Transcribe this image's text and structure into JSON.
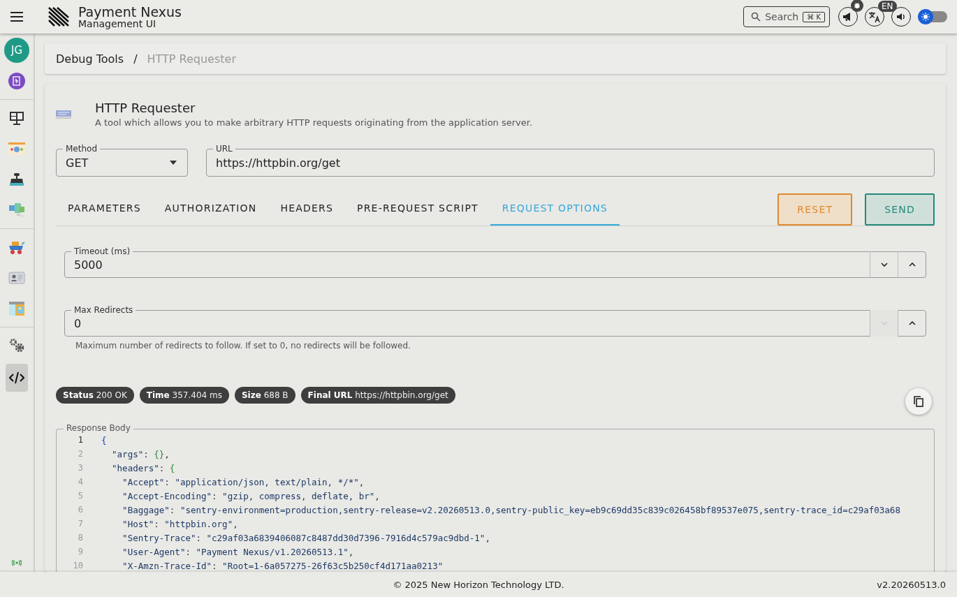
{
  "app": {
    "title": "Payment Nexus",
    "subtitle": "Management UI"
  },
  "toolbar": {
    "search_placeholder": "Search",
    "shortcut": "⌘ K",
    "language": "EN",
    "theme_toggle": {
      "on": false
    }
  },
  "sidebar": {
    "avatar": "JG",
    "items": [
      {
        "selected": false
      },
      {
        "selected": false
      },
      {
        "selected": false
      },
      {
        "selected": false
      },
      {
        "selected": false
      },
      {
        "selected": false
      },
      {
        "selected": false
      },
      {
        "selected": false
      },
      {
        "selected": false
      },
      {
        "selected": true
      }
    ]
  },
  "breadcrumb": {
    "items": [
      "Debug Tools",
      "HTTP Requester"
    ],
    "separator": "/"
  },
  "tool": {
    "title": "HTTP Requester",
    "description": "A tool which allows you to make arbitrary HTTP requests originating from the application server."
  },
  "method": {
    "label": "Method",
    "value": "GET"
  },
  "url": {
    "label": "URL",
    "value": "https://httpbin.org/get"
  },
  "tabs": [
    {
      "label": "PARAMETERS",
      "selected": false
    },
    {
      "label": "AUTHORIZATION",
      "selected": false
    },
    {
      "label": "HEADERS",
      "selected": false
    },
    {
      "label": "PRE-REQUEST SCRIPT",
      "selected": false
    },
    {
      "label": "REQUEST OPTIONS",
      "selected": true
    }
  ],
  "buttons": [
    {
      "label": "RESET",
      "kind": "reset"
    },
    {
      "label": "SEND",
      "kind": "send"
    }
  ],
  "options": [
    {
      "label": "Timeout (ms)",
      "value": "5000",
      "down_disabled": false,
      "up_disabled": false
    },
    {
      "label": "Max Redirects",
      "value": "0",
      "down_disabled": true,
      "up_disabled": false,
      "hint": "Maximum number of redirects to follow. If set to 0, no redirects will be followed."
    }
  ],
  "chips": [
    {
      "label": "Status",
      "value": "200 OK"
    },
    {
      "label": "Time",
      "value": "357.404 ms"
    },
    {
      "label": "Size",
      "value": "688 B"
    },
    {
      "label": "Final URL",
      "value": "https://httpbin.org/get"
    }
  ],
  "response": {
    "label": "Response Body",
    "lines": [
      {
        "n": "1",
        "current": true,
        "tokens": [
          {
            "kind": "brace",
            "text": "{"
          }
        ]
      },
      {
        "n": "2",
        "current": false,
        "tokens": [
          {
            "kind": "key",
            "text": "  \"args\""
          },
          {
            "kind": "punct",
            "text": ": "
          },
          {
            "kind": "bracket",
            "text": "{}"
          },
          {
            "kind": "punct",
            "text": ","
          }
        ]
      },
      {
        "n": "3",
        "current": false,
        "tokens": [
          {
            "kind": "key",
            "text": "  \"headers\""
          },
          {
            "kind": "punct",
            "text": ": "
          },
          {
            "kind": "bracket",
            "text": "{"
          }
        ]
      },
      {
        "n": "4",
        "current": false,
        "tokens": [
          {
            "kind": "key",
            "text": "    \"Accept\""
          },
          {
            "kind": "punct",
            "text": ": "
          },
          {
            "kind": "string",
            "text": "\"application/json, text/plain, */*\""
          },
          {
            "kind": "punct",
            "text": ","
          }
        ]
      },
      {
        "n": "5",
        "current": false,
        "tokens": [
          {
            "kind": "key",
            "text": "    \"Accept-Encoding\""
          },
          {
            "kind": "punct",
            "text": ": "
          },
          {
            "kind": "string",
            "text": "\"gzip, compress, deflate, br\""
          },
          {
            "kind": "punct",
            "text": ","
          }
        ]
      },
      {
        "n": "6",
        "current": false,
        "tokens": [
          {
            "kind": "key",
            "text": "    \"Baggage\""
          },
          {
            "kind": "punct",
            "text": ": "
          },
          {
            "kind": "string",
            "text": "\"sentry-environment=production,sentry-release=v2.20260513.0,sentry-public_key=eb9c69dd35c839c026458bf89537e075,sentry-trace_id=c29af03a68"
          }
        ]
      },
      {
        "n": "7",
        "current": false,
        "tokens": [
          {
            "kind": "key",
            "text": "    \"Host\""
          },
          {
            "kind": "punct",
            "text": ": "
          },
          {
            "kind": "string",
            "text": "\"httpbin.org\""
          },
          {
            "kind": "punct",
            "text": ","
          }
        ]
      },
      {
        "n": "8",
        "current": false,
        "tokens": [
          {
            "kind": "key",
            "text": "    \"Sentry-Trace\""
          },
          {
            "kind": "punct",
            "text": ": "
          },
          {
            "kind": "string",
            "text": "\"c29af03a6839406087c8487dd30d7396-7916d4c579ac9dbd-1\""
          },
          {
            "kind": "punct",
            "text": ","
          }
        ]
      },
      {
        "n": "9",
        "current": false,
        "tokens": [
          {
            "kind": "key",
            "text": "    \"User-Agent\""
          },
          {
            "kind": "punct",
            "text": ": "
          },
          {
            "kind": "string",
            "text": "\"Payment Nexus/v1.20260513.1\""
          },
          {
            "kind": "punct",
            "text": ","
          }
        ]
      },
      {
        "n": "10",
        "current": false,
        "tokens": [
          {
            "kind": "key",
            "text": "    \"X-Amzn-Trace-Id\""
          },
          {
            "kind": "punct",
            "text": ": "
          },
          {
            "kind": "string",
            "text": "\"Root=1-6a057275-26f63c5b250cf4d171aa0213\""
          }
        ]
      }
    ]
  },
  "footer": {
    "copyright": "© 2025 New Horizon Technology LTD.",
    "version": "v2.20260513.0"
  }
}
